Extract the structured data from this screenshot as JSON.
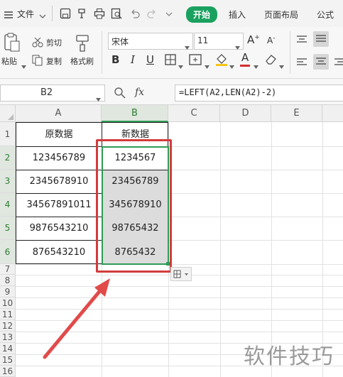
{
  "menu": {
    "file_label": "文件",
    "tabs": [
      "开始",
      "插入",
      "页面布局",
      "公式"
    ]
  },
  "ribbon": {
    "paste_label": "粘贴",
    "cut_label": "剪切",
    "copy_label": "复制",
    "format_painter_label": "格式刷",
    "font_name": "宋体",
    "font_size": "11"
  },
  "formula_bar": {
    "cell_ref": "B2",
    "fx_label": "fx",
    "formula": "=LEFT(A2,LEN(A2)-2)"
  },
  "sheet": {
    "columns": [
      "A",
      "B",
      "C",
      "D",
      "E"
    ],
    "rows": [
      "1",
      "2",
      "3",
      "4",
      "5",
      "6",
      "7",
      "8",
      "9",
      "10",
      "11",
      "12",
      "13",
      "14",
      "15",
      "16"
    ],
    "headers": [
      "原数据",
      "新数据"
    ],
    "data": [
      [
        "123456789",
        "1234567"
      ],
      [
        "2345678910",
        "23456789"
      ],
      [
        "34567891011",
        "345678910"
      ],
      [
        "9876543210",
        "98765432"
      ],
      [
        "876543210",
        "8765432"
      ]
    ]
  },
  "watermark": "软件技巧"
}
